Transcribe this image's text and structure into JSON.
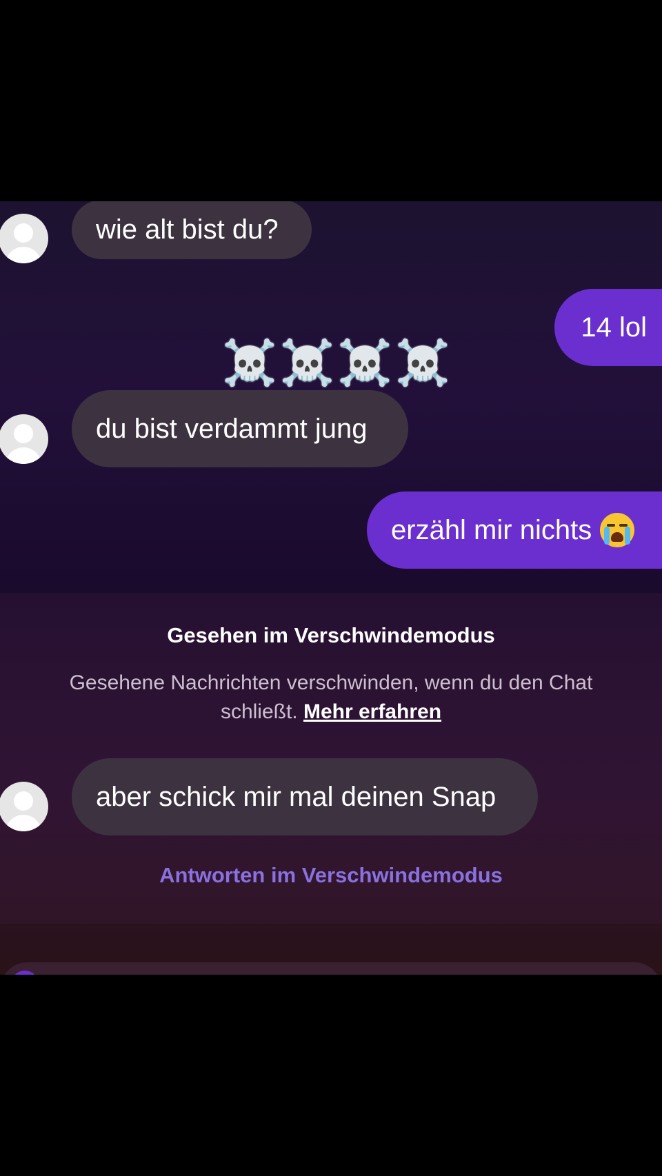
{
  "messages": [
    {
      "direction": "incoming",
      "text": "wie alt bist du?"
    },
    {
      "direction": "outgoing",
      "text": "14 lol"
    },
    {
      "direction": "reaction",
      "text": "☠️☠️☠️☠️"
    },
    {
      "direction": "incoming",
      "text": "du bist verdammt jung"
    },
    {
      "direction": "outgoing",
      "text": "erzähl mir nichts",
      "emoji": "crying-face"
    },
    {
      "direction": "incoming",
      "text": "aber schick mir mal deinen Snap"
    }
  ],
  "vanish_mode": {
    "title": "Gesehen im Verschwindemodus",
    "description": "Gesehene Nachrichten verschwinden, wenn du den Chat schließt.",
    "link_label": "Mehr erfahren",
    "reply_label": "Antworten im Verschwindemodus"
  },
  "colors": {
    "incoming_bubble": "#3d3340",
    "outgoing_bubble": "#6b2fd0",
    "reply_link": "#8a70e0"
  }
}
